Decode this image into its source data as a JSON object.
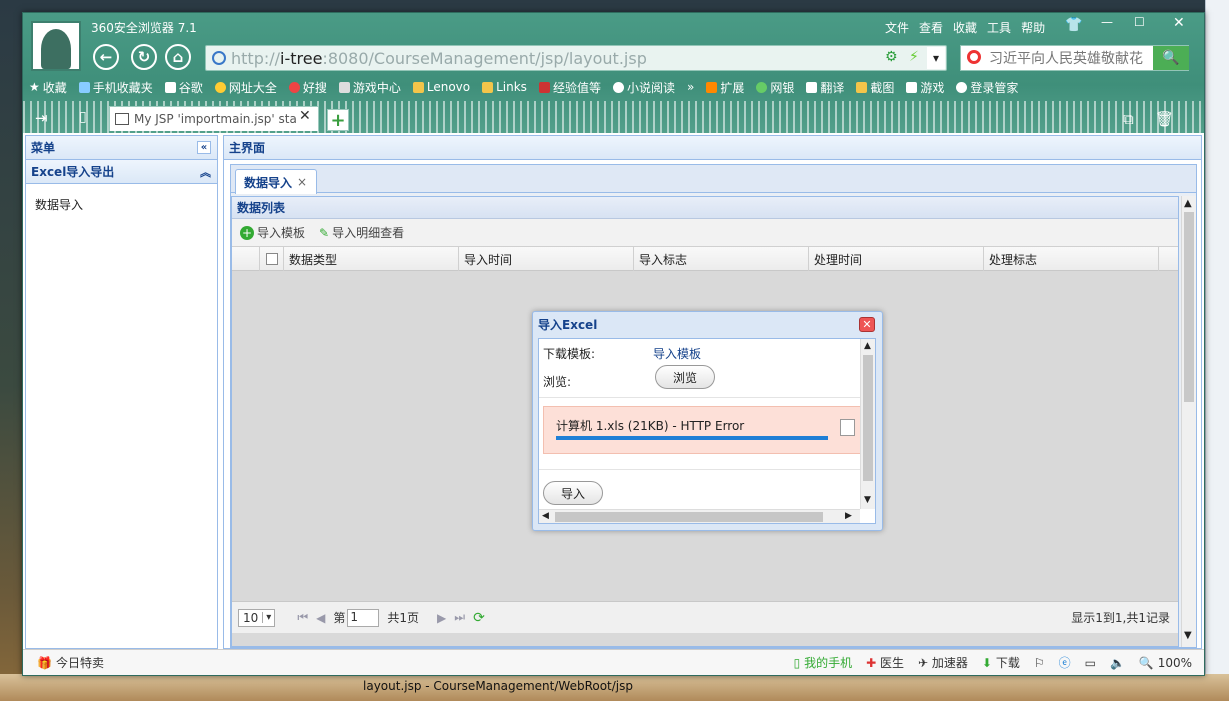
{
  "browser": {
    "title": "360安全浏览器 7.1",
    "menu": [
      "文件",
      "查看",
      "收藏",
      "工具",
      "帮助"
    ],
    "url_prefix": "http://",
    "url_host": "i-tree",
    "url_rest": ":8080/CourseManagement/jsp/layout.jsp",
    "search_placeholder": "习近平向人民英雄敬献花",
    "bookmarks": [
      "收藏",
      "手机收藏夹",
      "谷歌",
      "网址大全",
      "好搜",
      "游戏中心",
      "Lenovo",
      "Links",
      "经验值等",
      "小说阅读"
    ],
    "bookmarks_right": [
      "扩展",
      "网银",
      "翻译",
      "截图",
      "游戏",
      "登录管家"
    ],
    "tab_title": "My JSP 'importmain.jsp' sta"
  },
  "menu_panel": {
    "title": "菜单",
    "section": "Excel导入导出",
    "item": "数据导入"
  },
  "main_panel": {
    "title": "主界面",
    "tab": "数据导入",
    "grid_title": "数据列表",
    "toolbar": [
      "导入模板",
      "导入明细查看"
    ],
    "columns": [
      "数据类型",
      "导入时间",
      "导入标志",
      "处理时间",
      "处理标志"
    ],
    "pager": {
      "page_size": "10",
      "page_label": "第",
      "page_value": "1",
      "total_pages": "共1页",
      "summary": "显示1到1,共1记录"
    }
  },
  "dialog": {
    "title": "导入Excel",
    "download_label": "下载模板:",
    "download_link": "导入模板",
    "browse_label": "浏览:",
    "browse_button": "浏览",
    "file_status": "计算机 1.xls (21KB) - HTTP Error",
    "import_button": "导入"
  },
  "statusbar": {
    "left": "今日特卖",
    "items": [
      "我的手机",
      "医生",
      "加速器",
      "下载"
    ],
    "zoom": "100%"
  },
  "taskbar": {
    "text": "layout.jsp - CourseManagement/WebRoot/jsp"
  }
}
